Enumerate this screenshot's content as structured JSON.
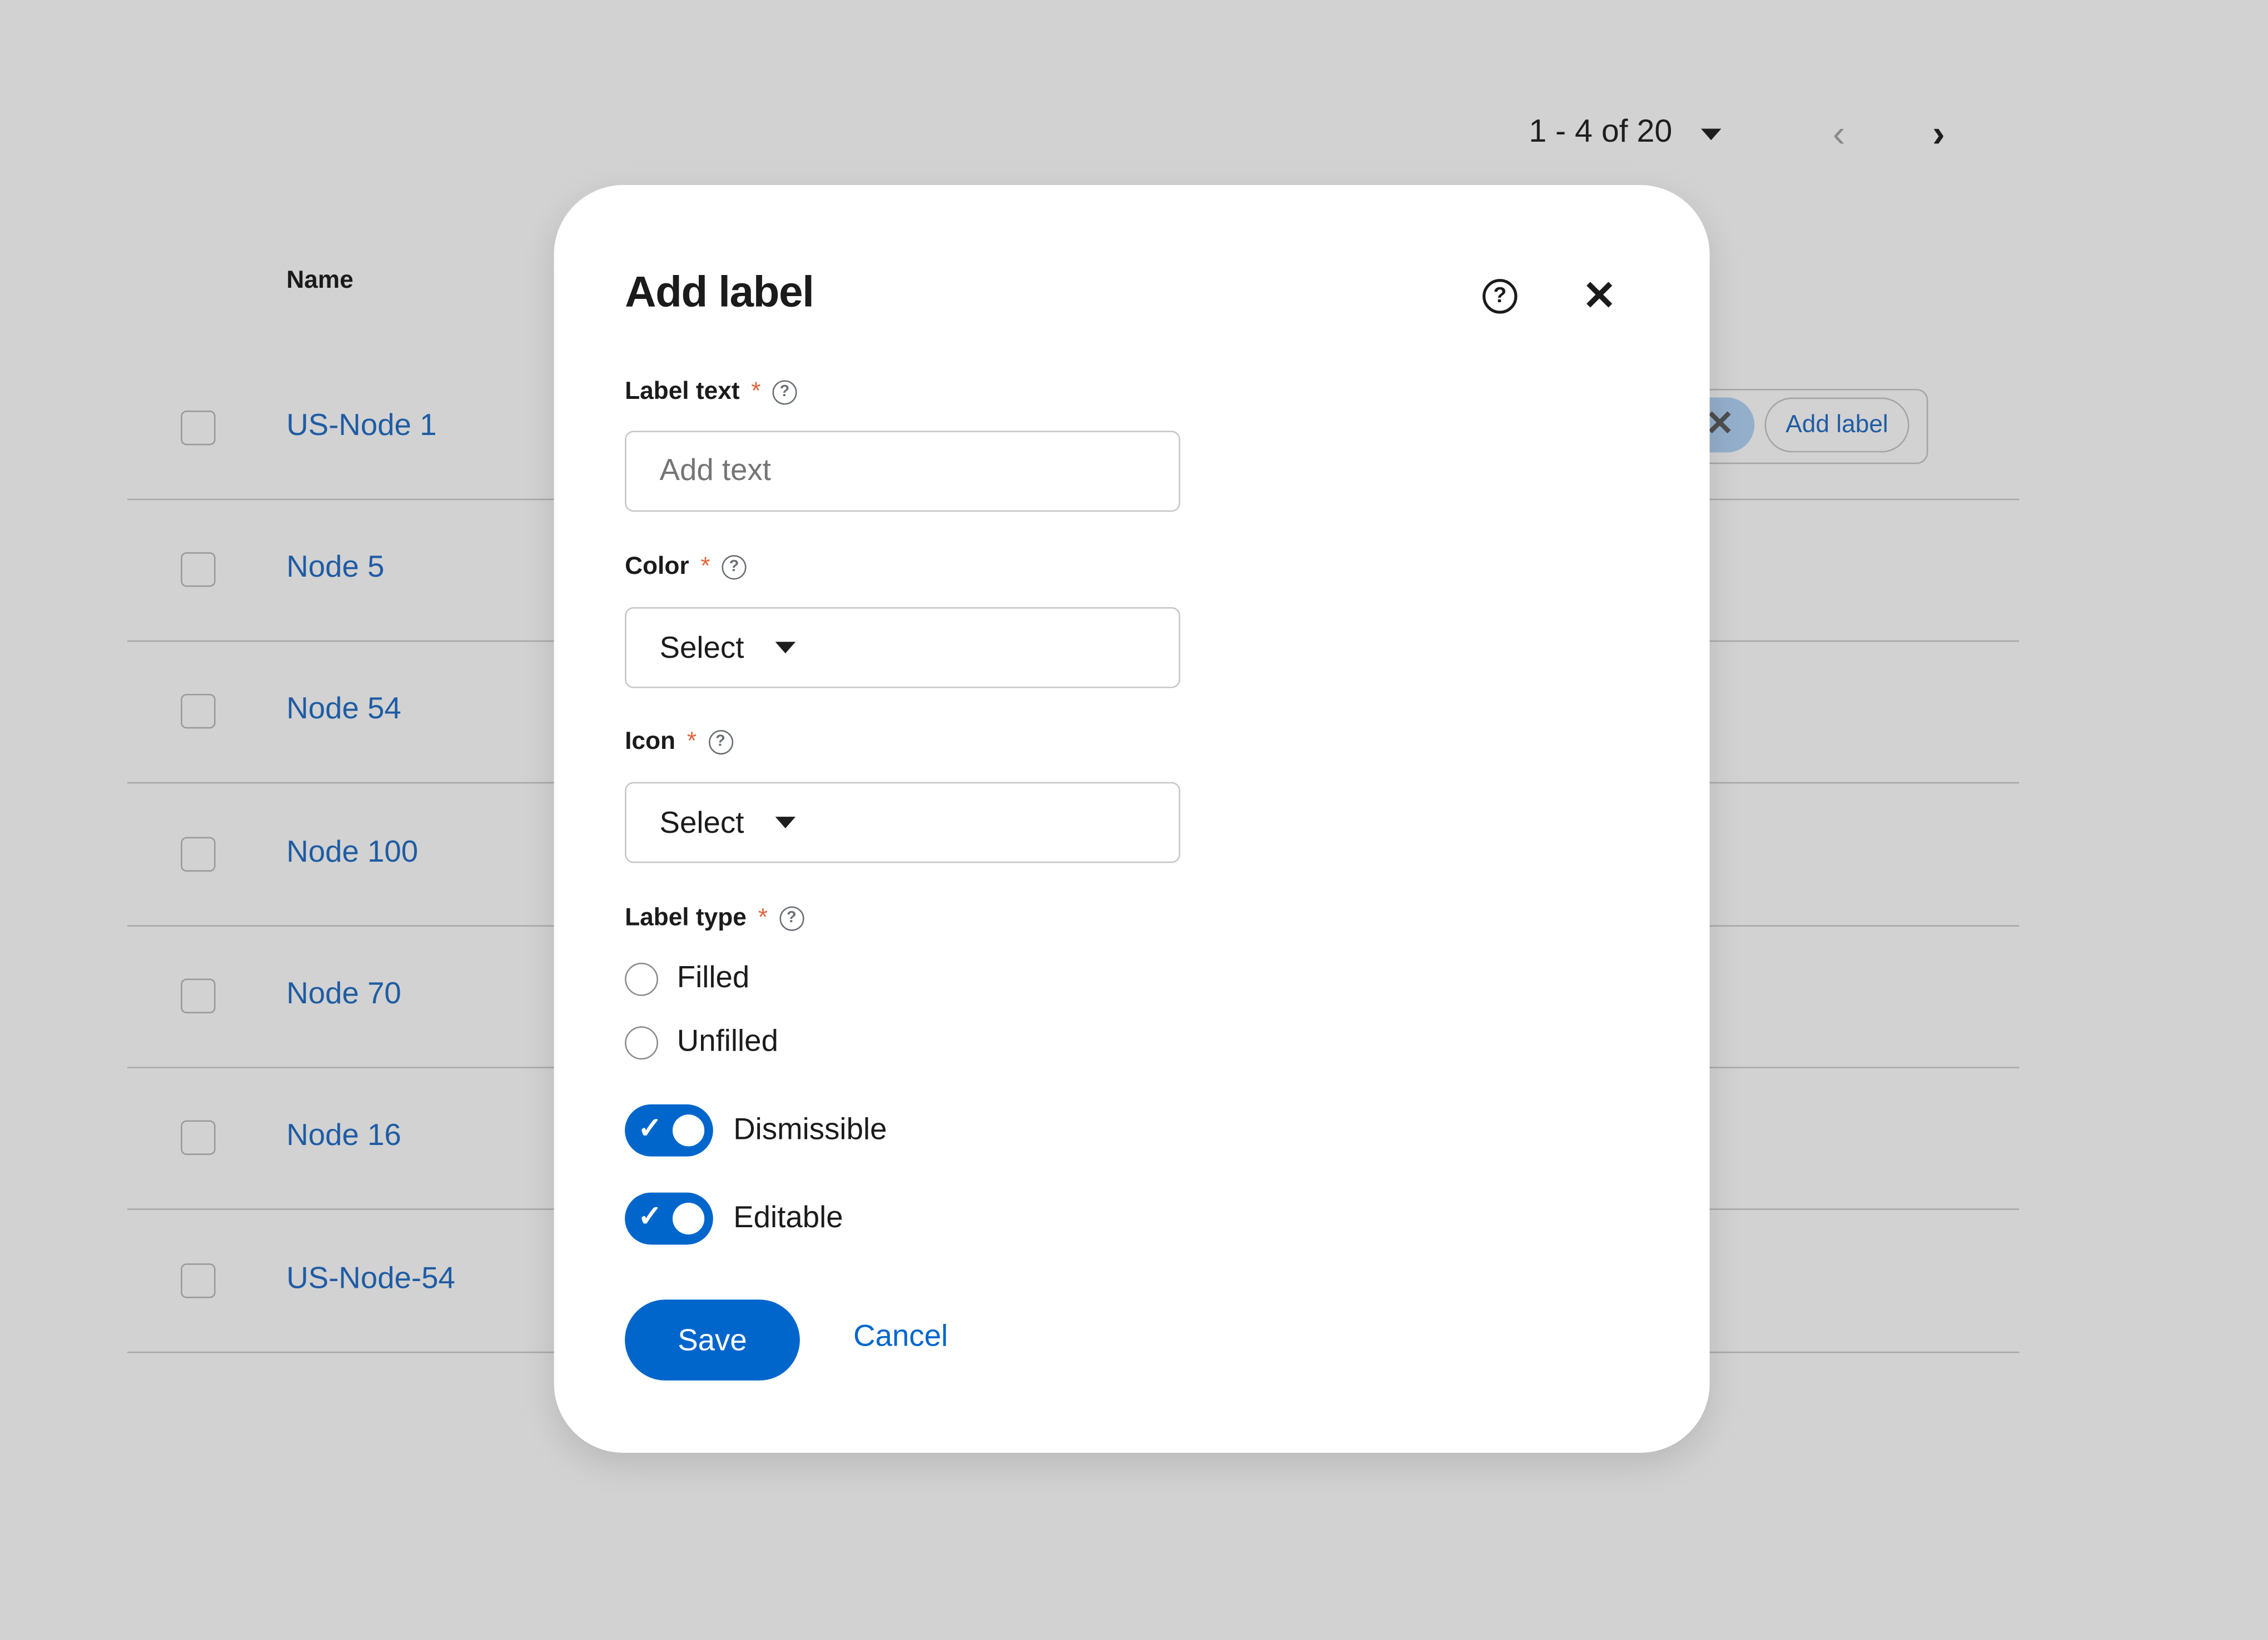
{
  "pagination": {
    "range": "1 - 4",
    "of_label": "of",
    "total": "20"
  },
  "table": {
    "header_name": "Name",
    "rows": [
      "US-Node 1",
      "Node 5",
      "Node 54",
      "Node 100",
      "Node 70",
      "Node 16",
      "US-Node-54"
    ],
    "label_group": {
      "add_label": "Add label"
    }
  },
  "modal": {
    "title": "Add label",
    "fields": {
      "label_text": {
        "label": "Label text",
        "required": "*",
        "placeholder": "Add text",
        "value": ""
      },
      "color": {
        "label": "Color",
        "required": "*",
        "value": "Select"
      },
      "icon": {
        "label": "Icon",
        "required": "*",
        "value": "Select"
      },
      "label_type": {
        "label": "Label type",
        "required": "*",
        "options": [
          "Filled",
          "Unfilled"
        ]
      }
    },
    "switches": {
      "dismissible": {
        "label": "Dismissible",
        "on": true
      },
      "editable": {
        "label": "Editable",
        "on": true
      }
    },
    "save": "Save",
    "cancel": "Cancel"
  },
  "colors": {
    "primary": "#0066cc",
    "required": "#e0643c",
    "backdrop": "#d2d2d2"
  }
}
